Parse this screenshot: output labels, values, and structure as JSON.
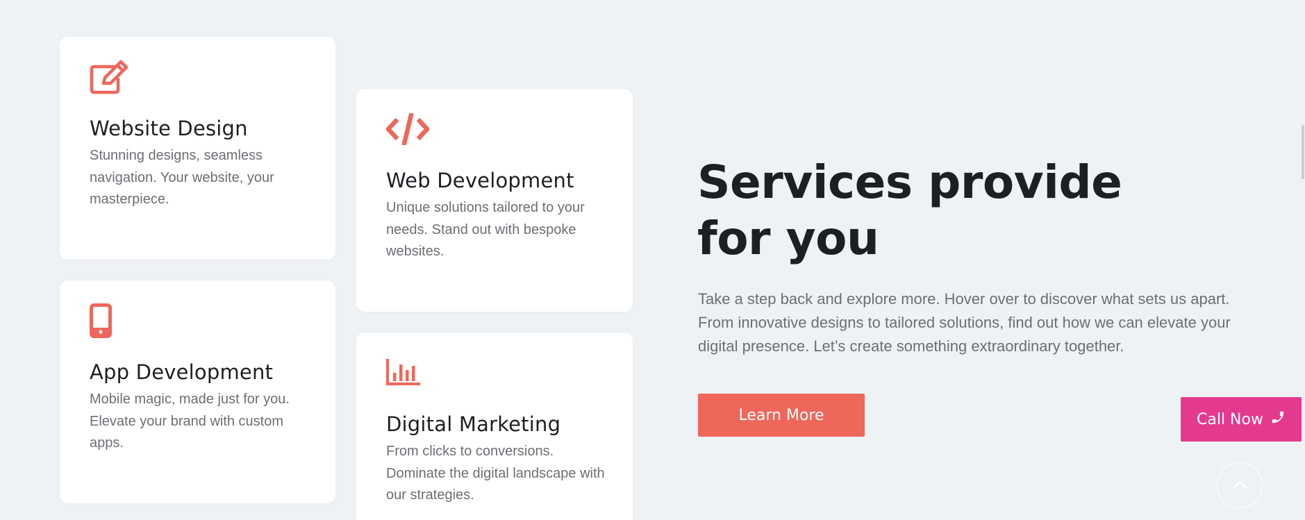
{
  "services": [
    {
      "title": "Website Design",
      "description": "Stunning designs, seamless navigation. Your website, your masterpiece.",
      "icon": "edit-icon"
    },
    {
      "title": "Web Development",
      "description": "Unique solutions tailored to your needs. Stand out with bespoke websites.",
      "icon": "code-icon"
    },
    {
      "title": "App Development",
      "description": "Mobile magic, made just for you. Elevate your brand with custom apps.",
      "icon": "mobile-phone-icon"
    },
    {
      "title": "Digital Marketing",
      "description": "From clicks to conversions. Dominate the digital landscape with our strategies.",
      "icon": "bar-chart-icon"
    }
  ],
  "section": {
    "heading_line1": "Services provide",
    "heading_line2": "for you",
    "description": "Take a step back and explore more. Hover over to discover what sets us apart. From innovative designs to tailored solutions, find out how we can elevate your digital presence. Let’s create something extraordinary together.",
    "cta_label": "Learn More"
  },
  "floating": {
    "call_label": "Call Now",
    "call_icon": "phone-icon",
    "scroll_top_icon": "chevron-up-icon"
  },
  "colors": {
    "accent": "#ee675a",
    "call_button": "#e33a8e",
    "background": "#eff2f5",
    "heading": "#1d1f23",
    "body_text": "#6b6e73"
  }
}
